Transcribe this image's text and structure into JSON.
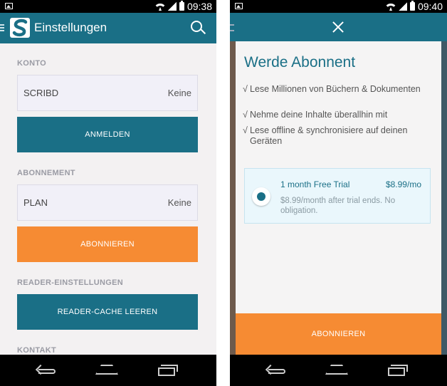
{
  "left": {
    "status": {
      "time": "09:38"
    },
    "appbar": {
      "title": "Einstellungen"
    },
    "sections": {
      "konto": "KONTO",
      "abonnement": "ABONNEMENT",
      "reader": "READER-EINSTELLUNGEN",
      "kontakt": "KONTAKT"
    },
    "account_field": {
      "label": "SCRIBD",
      "value": "Keine"
    },
    "login_button": "ANMELDEN",
    "plan_field": {
      "label": "PLAN",
      "value": "Keine"
    },
    "subscribe_button": "ABONNIEREN",
    "clear_cache_button": "READER-CACHE LEEREN"
  },
  "right": {
    "status": {
      "time": "09:40"
    },
    "modal": {
      "title": "Werde Abonnent",
      "check_glyph": "√",
      "benefits": [
        "Lese Millionen von Büchern & Dokumenten",
        "Nehme deine Inhalte überallhin mit",
        "Lese offline & synchronisiere auf deinen Geräten"
      ],
      "plan": {
        "name": "1 month Free Trial",
        "price": "$8.99/mo",
        "description": "$8.99/month after trial ends. No obligation."
      },
      "subscribe_button": "ABONNIEREN"
    }
  },
  "colors": {
    "brand_teal": "#1a6f86",
    "accent_orange": "#f68b33"
  }
}
